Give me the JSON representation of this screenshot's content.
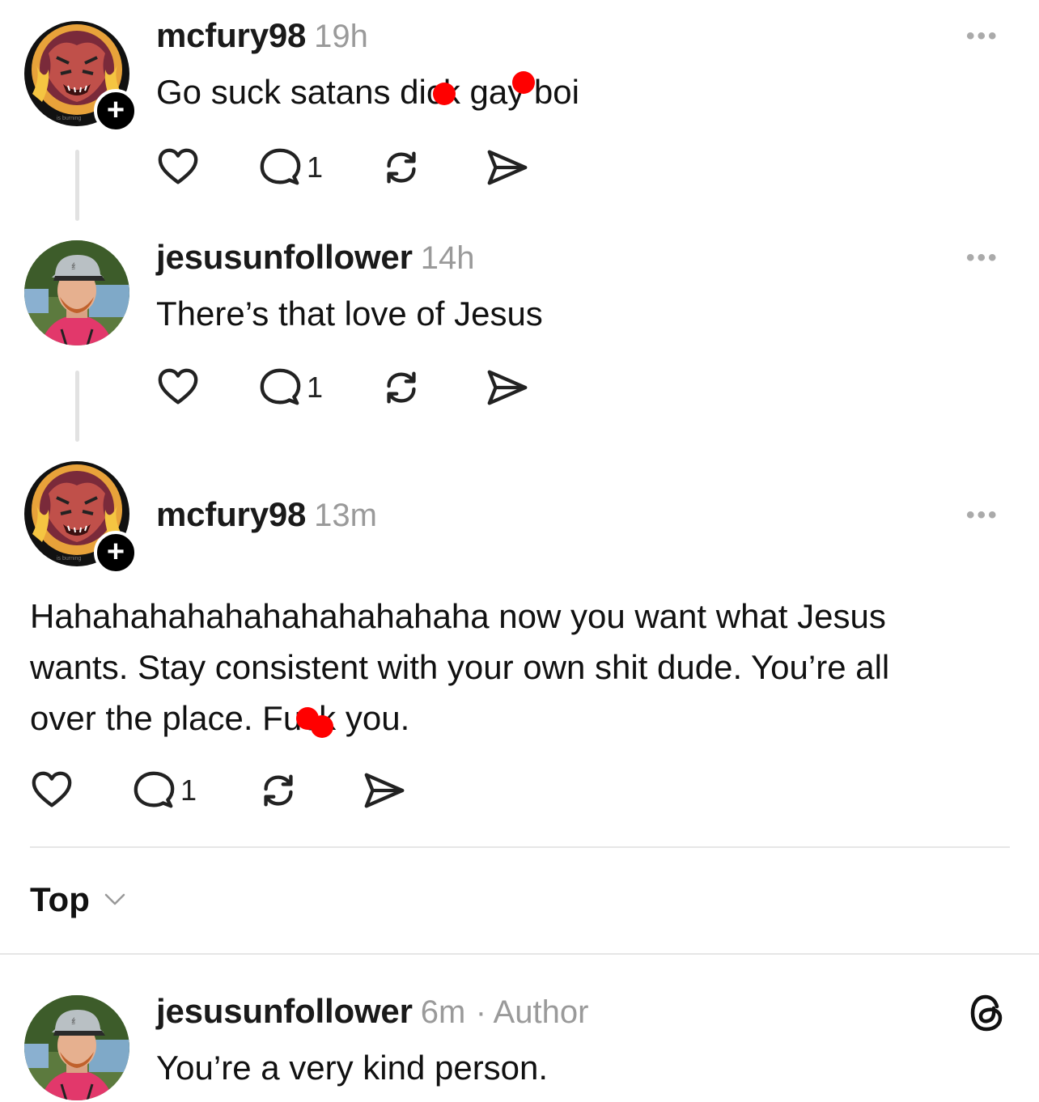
{
  "posts": [
    {
      "username": "mcfury98",
      "time": "19h",
      "text": "Go suck satans dick gay boi",
      "reply_count": "1",
      "more_label": "•••"
    },
    {
      "username": "jesusunfollower",
      "time": "14h",
      "text": "There’s that love of Jesus",
      "reply_count": "1",
      "more_label": "•••"
    },
    {
      "username": "mcfury98",
      "time": "13m",
      "text_lines": [
        "Hahahahahahahahahahahaha now you want what Jesus",
        "wants. Stay consistent with your own shit dude. You’re all",
        "over the place. Fuck you."
      ],
      "reply_count": "1",
      "more_label": "•••"
    }
  ],
  "sort": {
    "label": "Top"
  },
  "reply": {
    "username": "jesusunfollower",
    "time": "6m",
    "separator": "·",
    "author_badge": "Author",
    "text": "You’re a very kind person."
  },
  "icons": {
    "like": "heart-icon",
    "reply": "comment-icon",
    "repost": "repost-icon",
    "share": "send-icon",
    "threads": "threads-logo-icon",
    "follow": "plus-icon"
  },
  "avatar_overlay_text": "is burning",
  "colors": {
    "redaction": "#ff0000",
    "muted": "#9a9a9a",
    "divider": "#e6e6e6"
  }
}
